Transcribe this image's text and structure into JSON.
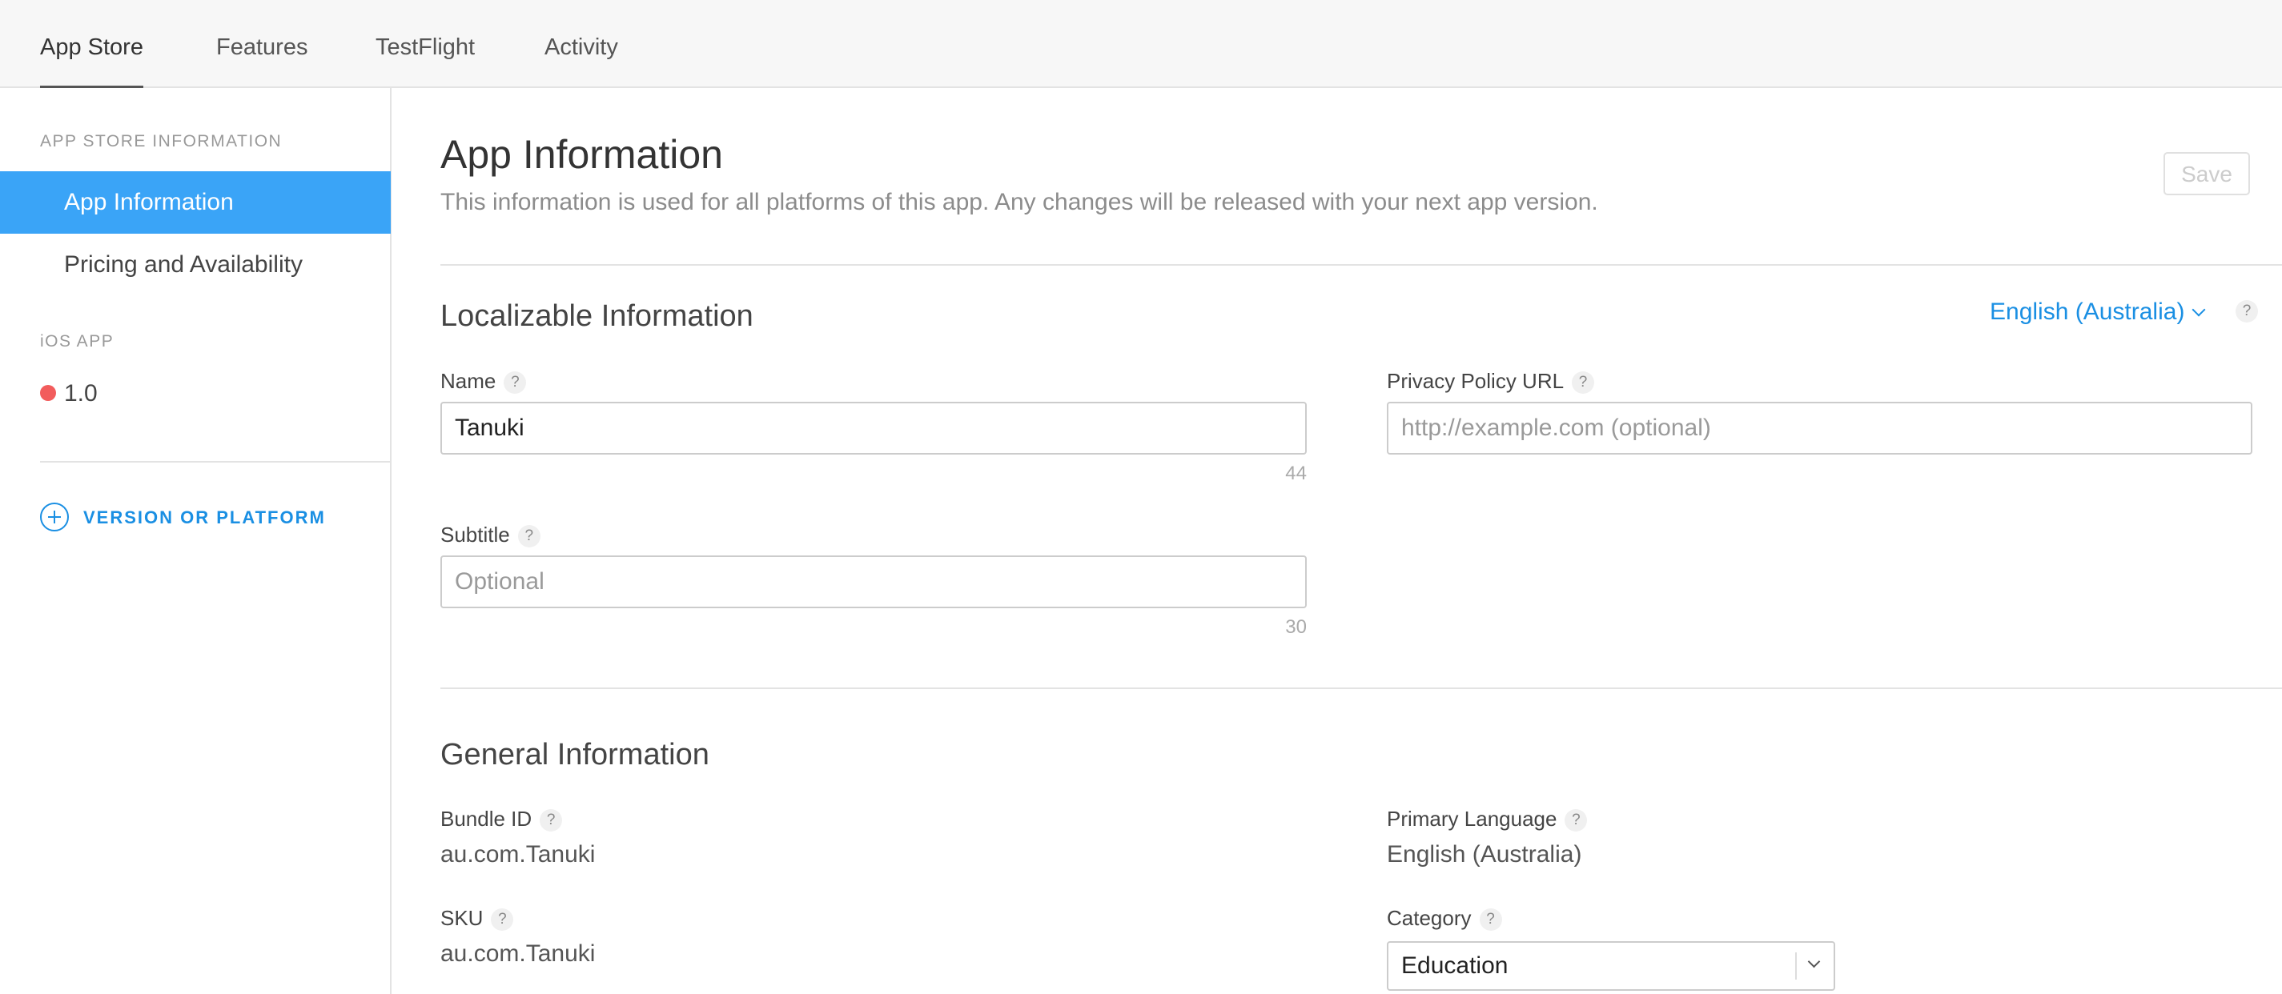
{
  "tabs": [
    {
      "label": "App Store"
    },
    {
      "label": "Features"
    },
    {
      "label": "TestFlight"
    },
    {
      "label": "Activity"
    }
  ],
  "sidebar": {
    "section_info": "APP STORE INFORMATION",
    "items": [
      {
        "label": "App Information"
      },
      {
        "label": "Pricing and Availability"
      }
    ],
    "section_ios": "iOS APP",
    "version": "1.0",
    "add_platform": "VERSION OR PLATFORM"
  },
  "main": {
    "title": "App Information",
    "subtitle": "This information is used for all platforms of this app. Any changes will be released with your next app version.",
    "save_label": "Save",
    "localizable": {
      "title": "Localizable Information",
      "language": "English (Australia)",
      "name_label": "Name",
      "name_value": "Tanuki",
      "name_counter": "44",
      "subtitle_label": "Subtitle",
      "subtitle_placeholder": "Optional",
      "subtitle_counter": "30",
      "privacy_label": "Privacy Policy URL",
      "privacy_placeholder": "http://example.com (optional)"
    },
    "general": {
      "title": "General Information",
      "bundle_label": "Bundle ID",
      "bundle_value": "au.com.Tanuki",
      "sku_label": "SKU",
      "sku_value": "au.com.Tanuki",
      "language_label": "Primary Language",
      "language_value": "English (Australia)",
      "category_label": "Category",
      "category_value": "Education"
    },
    "help_glyph": "?"
  },
  "colors": {
    "accent": "#1a8fe3",
    "selected_bg": "#3aa4f7",
    "status_dot": "#f25c5c"
  }
}
